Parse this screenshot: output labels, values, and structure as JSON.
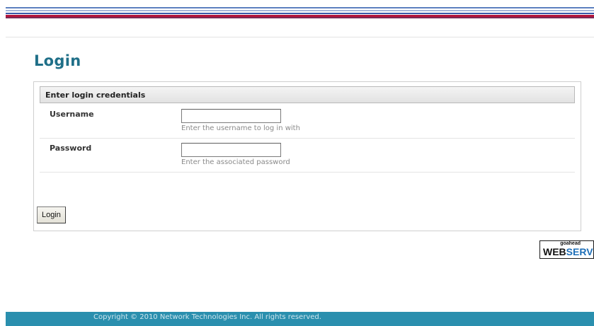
{
  "page": {
    "title": "Login"
  },
  "panel": {
    "header": "Enter login credentials",
    "username": {
      "label": "Username",
      "value": "",
      "hint": "Enter the username to log in with"
    },
    "password": {
      "label": "Password",
      "value": "",
      "hint": "Enter the associated password"
    },
    "login_button": "Login"
  },
  "badge": {
    "small_text": "goahead",
    "web_text": "WEB",
    "server_text": "SERVER"
  },
  "footer": {
    "copyright": "Copyright © 2010 Network Technologies Inc. All rights reserved."
  },
  "colors": {
    "title": "#1f6f88",
    "footer_bg": "#2a8fae",
    "banner_red": "#b3143a",
    "banner_blue": "#3a58a8"
  }
}
